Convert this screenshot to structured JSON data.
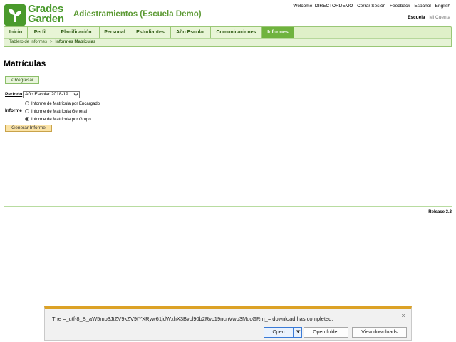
{
  "header": {
    "logo_line1": "Grades",
    "logo_line2": "Garden",
    "app_title": "Adiestramientos (Escuela Demo)",
    "welcome": "Welcome: DIRECTORDEMO",
    "links": [
      "Cerrar Sesión",
      "Feedback",
      "Español",
      "English"
    ],
    "scope_active": "Escuela",
    "scope_sep": "|",
    "scope_other": "Mi Cuenta"
  },
  "nav": {
    "tabs": [
      {
        "label": "Inicio"
      },
      {
        "label": "Perfil"
      },
      {
        "label": "Planificación"
      },
      {
        "label": "Personal"
      },
      {
        "label": "Estudiantes"
      },
      {
        "label": "Año Escolar"
      },
      {
        "label": "Comunicaciones"
      },
      {
        "label": "Informes"
      }
    ],
    "active_index": 7
  },
  "breadcrumb": {
    "parent": "Tablero de Informes",
    "separator": ">",
    "current": "Informes Matrículas"
  },
  "main": {
    "title": "Matrículas",
    "back_label": "< Regresar",
    "period_label": "Período",
    "period_value": "Año Escolar 2018-19",
    "report_label": "Informe",
    "report_options": [
      {
        "label": "Informe de Matrícula por Encargado",
        "checked": false
      },
      {
        "label": "Informe de Matrícula General",
        "checked": false
      },
      {
        "label": "Informe de Matrícula por Grupo",
        "checked": true
      }
    ],
    "generate_label": "Generar Informe"
  },
  "footer": {
    "release": "Release 3.3"
  },
  "download_bar": {
    "message": "The =_utf-8_B_aW5mb3JtZV9kZV9tYXRyw61jdWxhX3Bvcl90b2Rvc19ncnVwb3MucGRm_= download has completed.",
    "open_label": "Open",
    "open_folder_label": "Open folder",
    "view_downloads_label": "View downloads",
    "close_glyph": "×"
  },
  "colors": {
    "brand_green": "#4a9a2c",
    "title_green": "#5c9a34",
    "nav_active": "#6fb33e",
    "download_accent": "#dca226"
  }
}
